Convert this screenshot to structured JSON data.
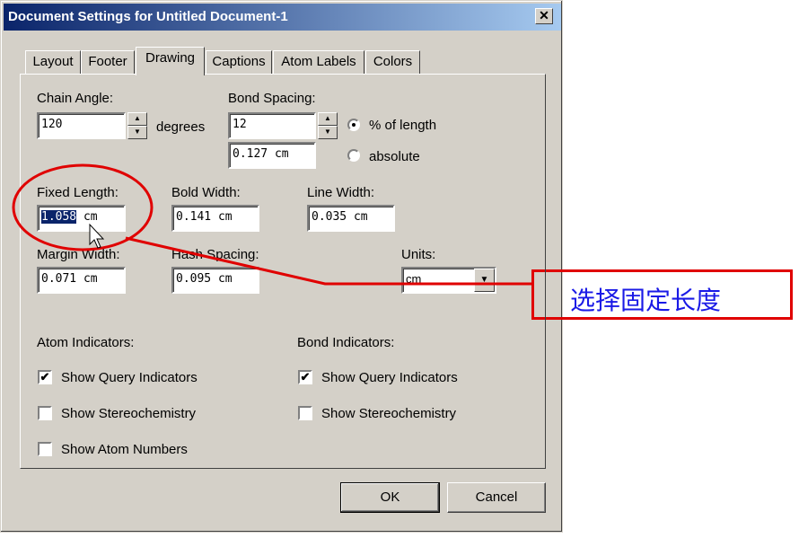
{
  "window": {
    "title": "Document Settings for Untitled Document-1",
    "close_glyph": "✕"
  },
  "tabs": [
    {
      "label": "Layout"
    },
    {
      "label": "Footer"
    },
    {
      "label": "Drawing",
      "active": true
    },
    {
      "label": "Captions"
    },
    {
      "label": "Atom Labels"
    },
    {
      "label": "Colors"
    }
  ],
  "drawing": {
    "chain_angle": {
      "label": "Chain Angle:",
      "value": "120",
      "unit": "degrees"
    },
    "bond_spacing": {
      "label": "Bond Spacing:",
      "value": "12",
      "absolute_value": "0.127  cm",
      "percent_label": "% of length",
      "absolute_label": "absolute",
      "selected": "percent"
    },
    "fixed_length": {
      "label": "Fixed Length:",
      "value_selected": "1.058",
      "value_rest": " cm"
    },
    "bold_width": {
      "label": "Bold Width:",
      "value": "0.141  cm"
    },
    "line_width": {
      "label": "Line Width:",
      "value": "0.035  cm"
    },
    "margin_width": {
      "label": "Margin Width:",
      "value": "0.071  cm"
    },
    "hash_spacing": {
      "label": "Hash Spacing:",
      "value": "0.095  cm"
    },
    "units": {
      "label": "Units:",
      "value": "cm"
    },
    "atom_indicators": {
      "label": "Atom Indicators:",
      "show_query": {
        "label": "Show Query Indicators",
        "checked": true
      },
      "show_stereo": {
        "label": "Show Stereochemistry",
        "checked": false
      },
      "show_numbers": {
        "label": "Show Atom Numbers",
        "checked": false
      }
    },
    "bond_indicators": {
      "label": "Bond Indicators:",
      "show_query": {
        "label": "Show Query Indicators",
        "checked": true
      },
      "show_stereo": {
        "label": "Show Stereochemistry",
        "checked": false
      }
    }
  },
  "buttons": {
    "ok": "OK",
    "cancel": "Cancel"
  },
  "annotation": {
    "callout_text": "选择固定长度",
    "color": "#e00000"
  },
  "icons": {
    "spin_up": "▲",
    "spin_down": "▼",
    "dropdown": "▼",
    "check": "✔"
  }
}
